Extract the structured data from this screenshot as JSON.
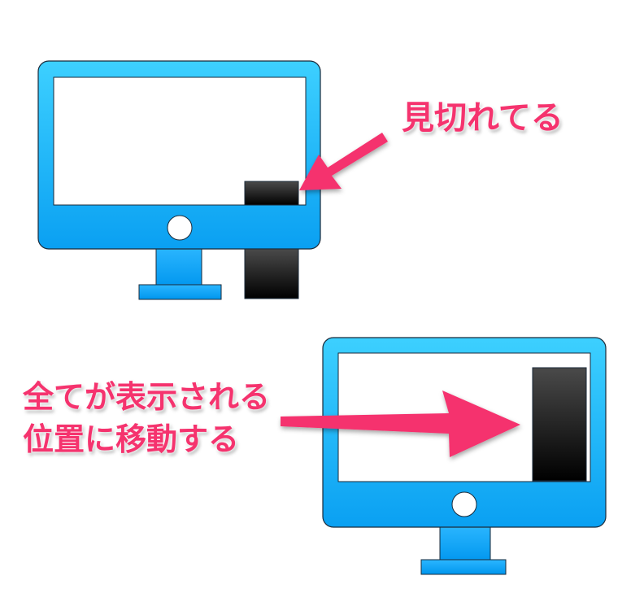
{
  "annotations": {
    "cut_off_label": "見切れてる",
    "moved_label_line1": "全てが表示される",
    "moved_label_line2": "位置に移動する"
  },
  "colors": {
    "monitor_blue_top": "#3dd0ff",
    "monitor_blue_bottom": "#0aa0f2",
    "outline": "#1a2a3a",
    "window_dark_top": "#4a4a4a",
    "window_dark_bottom": "#000000",
    "arrow_pink": "#f5336e",
    "screen_white": "#ffffff"
  },
  "icons": {
    "monitor": "monitor-icon",
    "power_button": "power-button-icon",
    "arrow": "arrow-icon"
  }
}
